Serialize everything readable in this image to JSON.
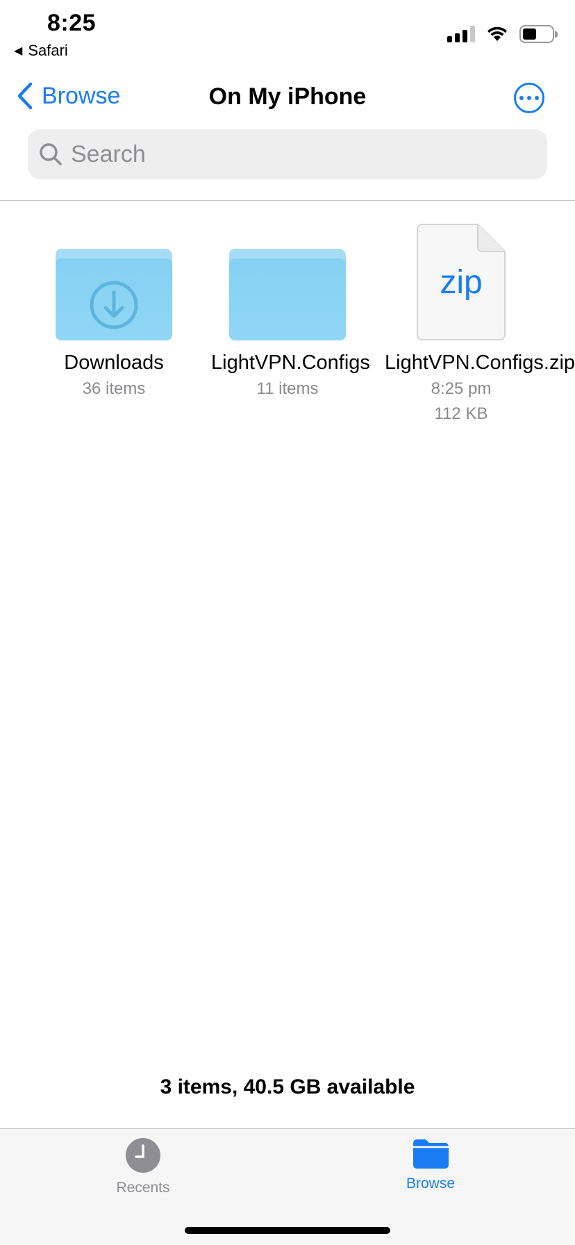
{
  "status_bar": {
    "time": "8:25",
    "back_app": "Safari"
  },
  "nav": {
    "back_label": "Browse",
    "title": "On My iPhone"
  },
  "search": {
    "placeholder": "Search",
    "value": ""
  },
  "items": [
    {
      "name": "Downloads",
      "meta1": "36 items",
      "type": "folder",
      "icon": "download-folder-icon"
    },
    {
      "name": "LightVPN.Configs",
      "meta1": "11 items",
      "type": "folder",
      "icon": "folder-icon"
    },
    {
      "name": "LightVPN.Configs.zip",
      "meta1": "8:25 pm",
      "meta2": "112 KB",
      "type": "zip",
      "icon": "zip-file-icon",
      "badge": "zip"
    }
  ],
  "footer": {
    "status": "3 items, 40.5 GB available"
  },
  "tabbar": {
    "recents_label": "Recents",
    "browse_label": "Browse",
    "selected": "Browse"
  },
  "colors": {
    "accent": "#1a7cf5",
    "folder": "#86d0f4",
    "secondary_text": "#8a8a8e"
  }
}
